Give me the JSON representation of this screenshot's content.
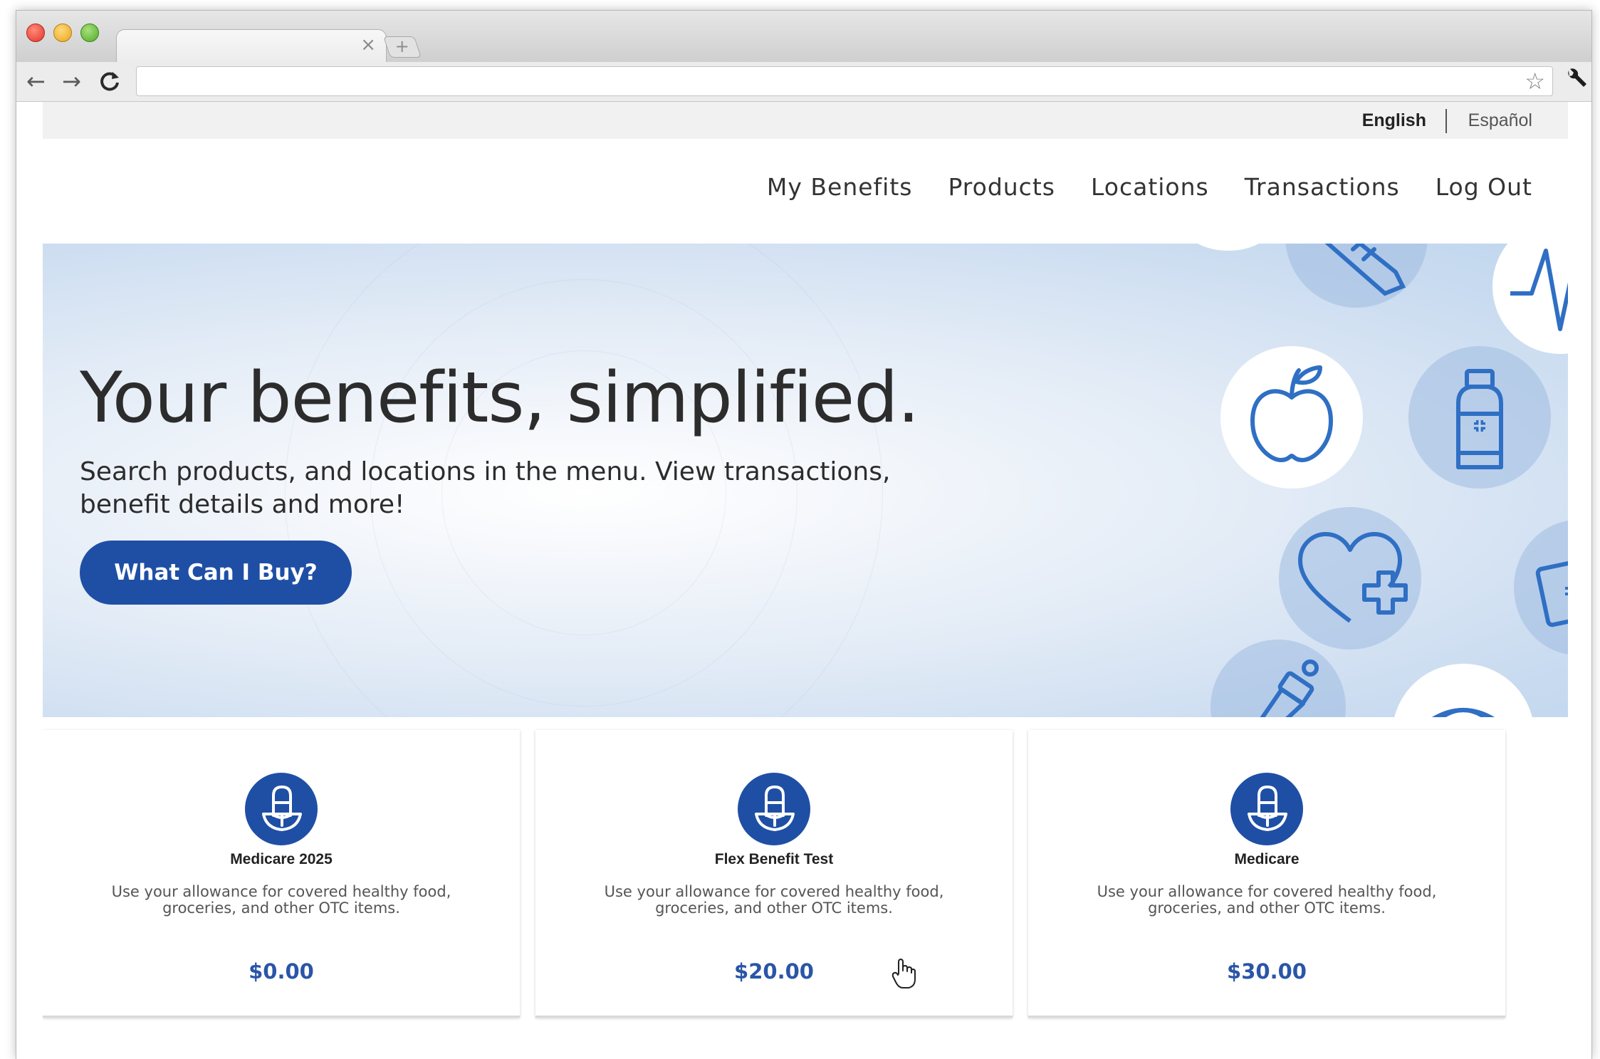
{
  "browser": {
    "tab_close": "×",
    "new_tab": "+",
    "back": "←",
    "forward": "→",
    "reload": "C",
    "star": "☆",
    "wrench": "🔧"
  },
  "language": {
    "english": "English",
    "spanish": "Español"
  },
  "nav": {
    "items": [
      {
        "label": "My Benefits"
      },
      {
        "label": "Products"
      },
      {
        "label": "Locations"
      },
      {
        "label": "Transactions"
      },
      {
        "label": "Log Out"
      }
    ]
  },
  "hero": {
    "title": "Your benefits, simplified.",
    "subtitle": "Search products, and locations in the menu. View transactions, benefit details and more!",
    "cta": "What Can I Buy?",
    "icons": [
      "thermometer-icon",
      "pulse-icon",
      "apple-icon",
      "medicine-bottle-icon",
      "heart-plus-icon",
      "first-aid-kit-icon",
      "baby-bottle-icon",
      "eye-icon"
    ]
  },
  "benefits": [
    {
      "title": "Medicare 2025",
      "description": "Use your allowance for covered healthy food, groceries, and other OTC items.",
      "amount": "$0.00",
      "icon": "pill-food-icon"
    },
    {
      "title": "Flex Benefit Test",
      "description": "Use your allowance for covered healthy food, groceries, and other OTC items.",
      "amount": "$20.00",
      "icon": "pill-food-icon"
    },
    {
      "title": "Medicare",
      "description": "Use your allowance for covered healthy food, groceries, and other OTC items.",
      "amount": "$30.00",
      "icon": "pill-food-icon"
    }
  ],
  "colors": {
    "brand_blue": "#1f4fa5",
    "amount_blue": "#2a55a8",
    "icon_line_blue": "#2f6fc4"
  }
}
